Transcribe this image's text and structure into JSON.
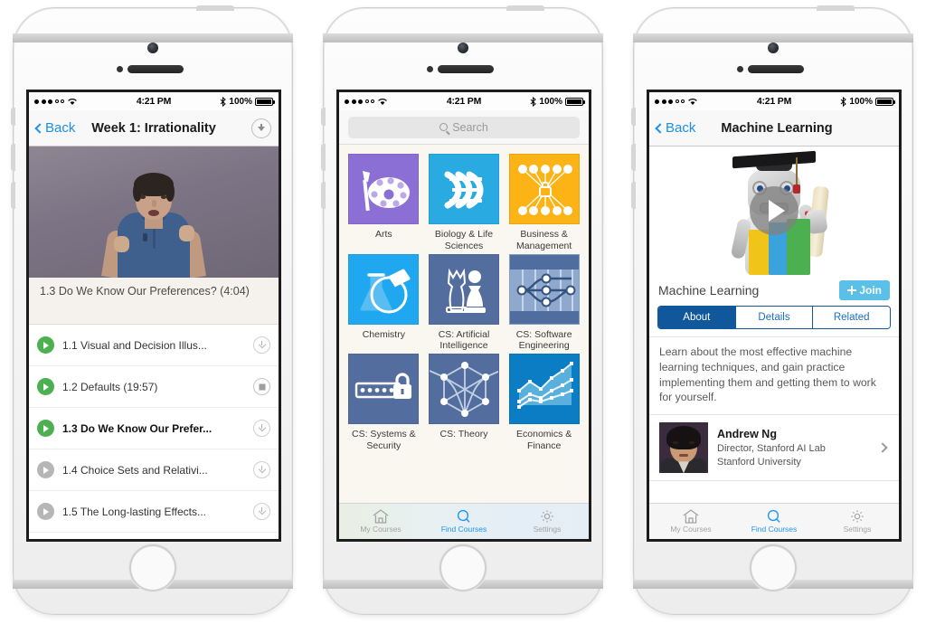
{
  "status_bar": {
    "time": "4:21 PM",
    "battery": "100%",
    "signal_dots": 5,
    "signal_filled": 3,
    "wifi_icon": "wifi-icon",
    "bluetooth_icon": "bluetooth-icon"
  },
  "phone1": {
    "nav": {
      "back_label": "Back",
      "title": "Week 1: Irrationality",
      "download_icon": "download-icon"
    },
    "video": {
      "caption_alt": "lecturer-video-frame"
    },
    "now_playing": "1.3 Do We Know Our Preferences? (4:04)",
    "lessons": [
      {
        "title": "1.1 Visual and Decision Illus...",
        "state": "available",
        "play_icon": "play-icon",
        "action_icon": "download-icon",
        "active": false
      },
      {
        "title": "1.2 Defaults (19:57)",
        "state": "available",
        "play_icon": "play-icon",
        "action_icon": "stop-download-icon",
        "active": false
      },
      {
        "title": "1.3 Do We Know Our Prefer...",
        "state": "available",
        "play_icon": "play-icon",
        "action_icon": "download-icon",
        "active": true
      },
      {
        "title": "1.4 Choice Sets and Relativi...",
        "state": "locked",
        "play_icon": "play-icon",
        "action_icon": "download-icon",
        "active": false
      },
      {
        "title": "1.5 The Long-lasting Effects...",
        "state": "locked",
        "play_icon": "play-icon",
        "action_icon": "download-icon",
        "active": false
      }
    ]
  },
  "phone2": {
    "search": {
      "placeholder": "Search",
      "icon": "search-icon"
    },
    "categories": [
      {
        "label": "Arts",
        "icon": "palette-icon",
        "color": "#8c6fd4"
      },
      {
        "label": "Biology & Life Sciences",
        "icon": "dna-icon",
        "color": "#29abe2"
      },
      {
        "label": "Business & Management",
        "icon": "network-briefcase-icon",
        "color": "#fbb315"
      },
      {
        "label": "Chemistry",
        "icon": "flask-icon",
        "color": "#1fa7f0"
      },
      {
        "label": "CS: Artificial Intelligence",
        "icon": "chess-icon",
        "color": "#536e9e"
      },
      {
        "label": "CS: Software Engineering",
        "icon": "branch-graph-icon",
        "color": "#6f8cbb"
      },
      {
        "label": "CS: Systems & Security",
        "icon": "password-lock-icon",
        "color": "#536e9e"
      },
      {
        "label": "CS: Theory",
        "icon": "graph-nodes-icon",
        "color": "#536e9e"
      },
      {
        "label": "Economics & Finance",
        "icon": "line-chart-icon",
        "color": "#0a7dc4"
      }
    ],
    "tabs": [
      {
        "label": "My Courses",
        "icon": "home-icon",
        "active": false
      },
      {
        "label": "Find Courses",
        "icon": "search-icon",
        "active": true
      },
      {
        "label": "Settings",
        "icon": "gear-icon",
        "active": false
      }
    ]
  },
  "phone3": {
    "nav": {
      "back_label": "Back",
      "title": "Machine Learning"
    },
    "hero": {
      "play_icon": "play-button-icon",
      "alt": "robot-graduate-image"
    },
    "course_title": "Machine Learning",
    "join_label": "Join",
    "join_icon": "plus-icon",
    "segments": [
      {
        "label": "About",
        "active": true
      },
      {
        "label": "Details",
        "active": false
      },
      {
        "label": "Related",
        "active": false
      }
    ],
    "description": "Learn about the most effective machine learning techniques, and gain practice implementing them and getting them to work for yourself.",
    "instructor": {
      "name": "Andrew Ng",
      "role": "Director, Stanford AI Lab",
      "org": "Stanford University",
      "chevron_icon": "chevron-right-icon",
      "avatar": "instructor-avatar"
    },
    "tabs": [
      {
        "label": "My Courses",
        "icon": "home-icon",
        "active": false
      },
      {
        "label": "Find Courses",
        "icon": "search-icon",
        "active": true
      },
      {
        "label": "Settings",
        "icon": "gear-icon",
        "active": false
      }
    ]
  },
  "colors": {
    "ios_blue": "#1e8fe8",
    "green": "#4cb050",
    "dark_blue": "#11579b",
    "join_blue": "#5bc0e8"
  }
}
